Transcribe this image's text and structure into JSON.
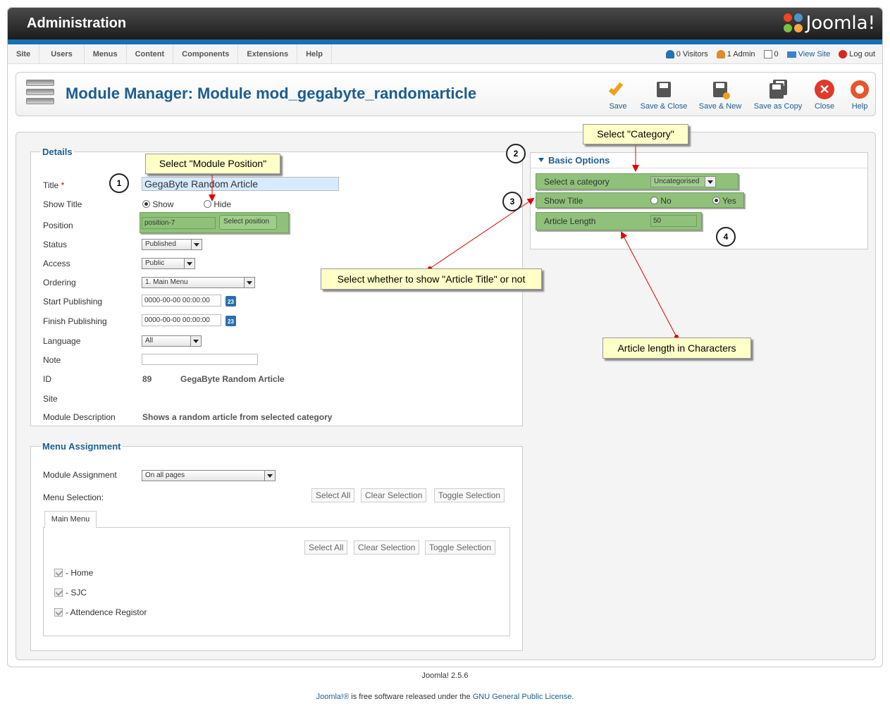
{
  "app_title": "Administration",
  "logo_text": "Joomla!",
  "menu": [
    "Site",
    "Users",
    "Menus",
    "Content",
    "Components",
    "Extensions",
    "Help"
  ],
  "status": {
    "visitors": "0 Visitors",
    "admins": "1 Admin",
    "messages": "0",
    "view_site": "View Site",
    "logout": "Log out"
  },
  "page_title": "Module Manager: Module mod_gegabyte_randomarticle",
  "toolbar": {
    "save": "Save",
    "save_close": "Save & Close",
    "save_new": "Save & New",
    "save_copy": "Save as Copy",
    "close": "Close",
    "help": "Help"
  },
  "details": {
    "legend": "Details",
    "title_label": "Title",
    "title_value": "GegaByte Random Article",
    "show_title_label": "Show Title",
    "show_label": "Show",
    "hide_label": "Hide",
    "position_label": "Position",
    "position_value": "position-7",
    "select_position": "Select position",
    "status_label": "Status",
    "status_value": "Published",
    "access_label": "Access",
    "access_value": "Public",
    "ordering_label": "Ordering",
    "ordering_value": "1. Main Menu",
    "start_label": "Start Publishing",
    "start_value": "0000-00-00 00:00:00",
    "finish_label": "Finish Publishing",
    "finish_value": "0000-00-00 00:00:00",
    "cal_text": "23",
    "language_label": "Language",
    "language_value": "All",
    "note_label": "Note",
    "id_label": "ID",
    "id_value": "89",
    "id_name": "GegaByte Random Article",
    "site_label": "Site",
    "desc_label": "Module Description",
    "desc_value": "Shows a random article from selected category"
  },
  "menu_assignment": {
    "legend": "Menu Assignment",
    "module_assignment_label": "Module Assignment",
    "module_assignment_value": "On all pages",
    "menu_selection_label": "Menu Selection:",
    "select_all": "Select All",
    "clear_selection": "Clear Selection",
    "toggle_selection": "Toggle Selection",
    "tab": "Main Menu",
    "items": [
      "- Home",
      "- SJC",
      "- Attendence Registor"
    ]
  },
  "basic_options": {
    "header": "Basic Options",
    "category_label": "Select a category",
    "category_value": "Uncategorised",
    "show_title_label": "Show Title",
    "no_label": "No",
    "yes_label": "Yes",
    "length_label": "Article Length",
    "length_value": "50"
  },
  "callouts": {
    "position": "Select \"Module Position\"",
    "category": "Select \"Category\"",
    "show_title": "Select whether to show \"Article Title\" or not",
    "length": "Article length in Characters"
  },
  "numbers": [
    "1",
    "2",
    "3",
    "4"
  ],
  "footer": {
    "version": "Joomla! 2.5.6",
    "license_prefix": "Joomla!®",
    "license_mid": " is free software released under the ",
    "license_link": "GNU General Public License",
    "license_end": "."
  },
  "colors": {
    "accent": "#1d5d90",
    "highlight": "#8fc17a",
    "callout": "#ffffc8",
    "arrow": "#e00000"
  }
}
